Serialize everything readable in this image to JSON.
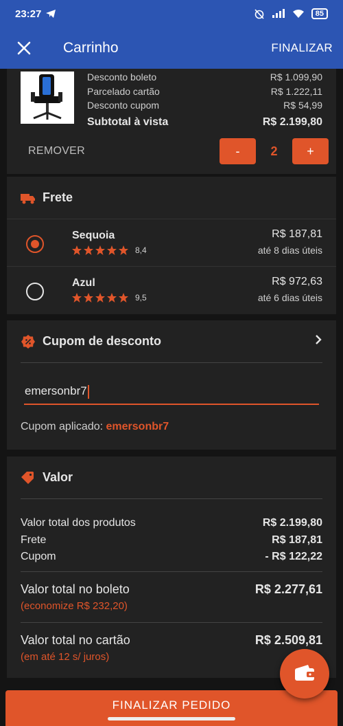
{
  "status": {
    "time": "23:27",
    "battery": "85"
  },
  "appbar": {
    "title": "Carrinho",
    "action": "FINALIZAR"
  },
  "product": {
    "rows": [
      {
        "label": "Desconto boleto",
        "value": "R$ 1.099,90"
      },
      {
        "label": "Parcelado cartão",
        "value": "R$ 1.222,11"
      },
      {
        "label": "Desconto cupom",
        "value": "R$ 54,99"
      }
    ],
    "subtotal_label": "Subtotal à vista",
    "subtotal_value": "R$ 2.199,80",
    "remove_label": "REMOVER",
    "qty_minus": "-",
    "qty_value": "2",
    "qty_plus": "+"
  },
  "frete": {
    "title": "Frete",
    "options": [
      {
        "name": "Sequoia",
        "rating": "8,4",
        "stars": 4.5,
        "price": "R$ 187,81",
        "eta": "até 8 dias úteis",
        "selected": true
      },
      {
        "name": "Azul",
        "rating": "9,5",
        "stars": 4.5,
        "price": "R$ 972,63",
        "eta": "até 6 dias úteis",
        "selected": false
      }
    ]
  },
  "cupom": {
    "title": "Cupom de desconto",
    "input_value": "emersonbr7",
    "applied_label": "Cupom aplicado:",
    "applied_code": "emersonbr7"
  },
  "valor": {
    "title": "Valor",
    "rows": [
      {
        "label": "Valor total dos produtos",
        "value": "R$ 2.199,80"
      },
      {
        "label": "Frete",
        "value": "R$ 187,81"
      },
      {
        "label": "Cupom",
        "value": "- R$ 122,22"
      }
    ],
    "boleto": {
      "label": "Valor total no boleto",
      "value": "R$ 2.277,61",
      "note": "(economize R$ 232,20)"
    },
    "cartao": {
      "label": "Valor total no cartão",
      "value": "R$ 2.509,81",
      "note": "(em até 12 s/ juros)"
    }
  },
  "footer": {
    "button": "FINALIZAR PEDIDO"
  },
  "colors": {
    "accent": "#e0552a",
    "appbar": "#2c55b3",
    "card": "#222222",
    "background": "#141414"
  }
}
